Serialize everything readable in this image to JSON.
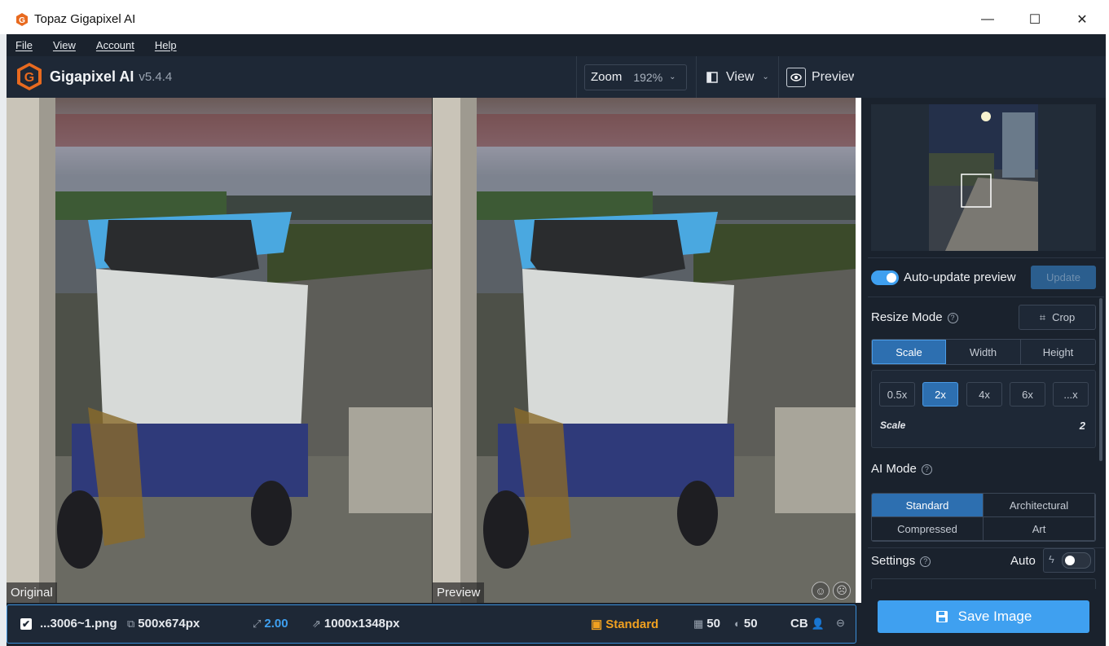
{
  "window": {
    "title": "Topaz Gigapixel AI",
    "minimize": "—",
    "maximize": "☐",
    "close": "✕"
  },
  "menu": [
    "File",
    "View",
    "Account",
    "Help"
  ],
  "header": {
    "app_name": "Gigapixel AI",
    "version": "v5.4.4",
    "zoom_label": "Zoom",
    "zoom_value": "192%",
    "view_label": "View",
    "preview_label": "Preview"
  },
  "panes": {
    "left_label": "Original",
    "right_label": "Preview"
  },
  "file_row": {
    "filename": "...3006~1.png",
    "input_size": "500x674px",
    "scale": "2.00",
    "output_size": "1000x1348px",
    "model": "Standard",
    "noise": "50",
    "blur": "50",
    "cb": "CB"
  },
  "right_panel": {
    "auto_update_label": "Auto-update preview",
    "auto_update_on": true,
    "update_button": "Update",
    "resize_mode_label": "Resize Mode",
    "crop_button": "Crop",
    "resize_tabs": [
      "Scale",
      "Width",
      "Height"
    ],
    "resize_active": "Scale",
    "scale_options": [
      "0.5x",
      "2x",
      "4x",
      "6x",
      "...x"
    ],
    "scale_active": "2x",
    "scale_label": "Scale",
    "scale_value": "2",
    "ai_mode_label": "AI Mode",
    "ai_modes": [
      "Standard",
      "Architectural",
      "Compressed",
      "Art"
    ],
    "ai_active": "Standard",
    "settings_label": "Settings",
    "auto_label": "Auto",
    "auto_on": false,
    "save_button": "Save Image"
  },
  "colors": {
    "accent": "#3fa0f0",
    "panel": "#1e2836",
    "model_badge": "#f0a020"
  }
}
